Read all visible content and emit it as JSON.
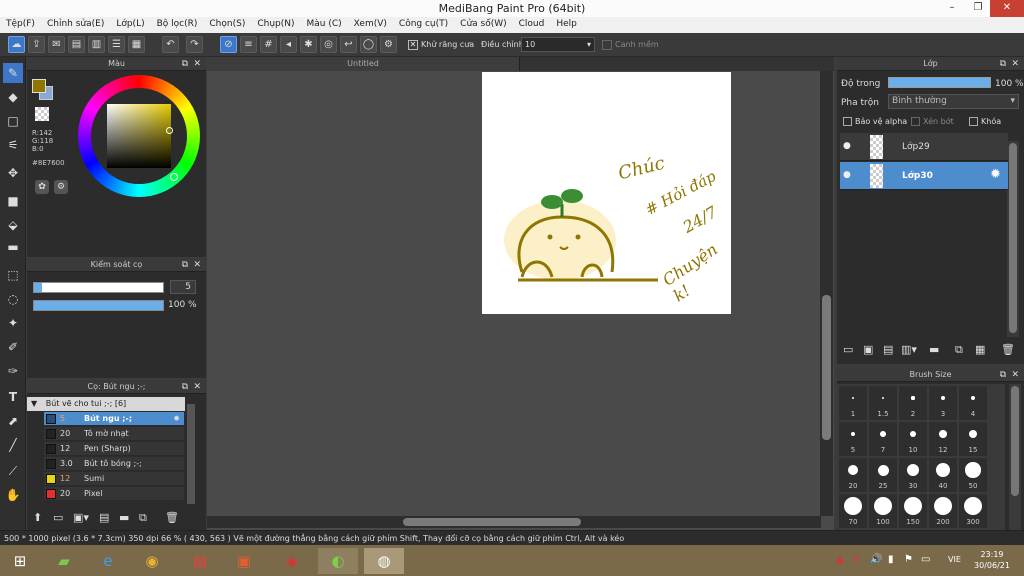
{
  "window": {
    "title": "MediBang Paint Pro (64bit)"
  },
  "menu": [
    "Tệp(F)",
    "Chỉnh sửa(E)",
    "Lớp(L)",
    "Bộ lọc(R)",
    "Chọn(S)",
    "Chụp(N)",
    "Màu (C)",
    "Xem(V)",
    "Công cụ(T)",
    "Cửa số(W)",
    "Cloud",
    "Help"
  ],
  "toolbar": {
    "antialias_label": "Khử răng cưa",
    "correction_label": "Điều chỉnh",
    "correction_value": "10",
    "edge_label": "Canh mềm"
  },
  "color_panel": {
    "title": "Màu",
    "r": "R:142",
    "g": "G:118",
    "b": "B:0",
    "hex": "#8E7600",
    "main_color": "#8E7600",
    "sub_color": "#ffffff"
  },
  "brush_control": {
    "title": "Kiểm soát cọ",
    "size": "5",
    "size_fraction": 0.06,
    "opacity": "100 %",
    "opacity_fraction": 1.0
  },
  "brush_panel": {
    "title": "Cọ: Bút ngu ;-;",
    "group": "Bút vẽ cho tui ;-; [6]",
    "items": [
      {
        "size": "5",
        "name": "Bút ngu ;-;",
        "color": "#2b4f7a"
      },
      {
        "size": "20",
        "name": "Tô mờ nhạt",
        "color": "#222222"
      },
      {
        "size": "12",
        "name": "Pen (Sharp)",
        "color": "#222222"
      },
      {
        "size": "3.0",
        "name": "Bút tô bóng ;-;",
        "color": "#222222"
      },
      {
        "size": "12",
        "name": "Sumi",
        "color": "#e7d21c"
      },
      {
        "size": "20",
        "name": "Pixel",
        "color": "#e03030"
      }
    ]
  },
  "document": {
    "tab": "Untitled"
  },
  "layer_panel": {
    "title": "Lớp",
    "opacity_label": "Độ trong",
    "opacity_value": "100 %",
    "blend_label": "Pha trộn",
    "blend_value": "Bình thường",
    "protect_alpha": "Bảo vệ alpha",
    "clipping": "Xén bớt",
    "lock": "Khóa",
    "layers": [
      {
        "name": "Lớp29",
        "selected": false
      },
      {
        "name": "Lớp30",
        "selected": true
      }
    ]
  },
  "brush_size_panel": {
    "title": "Brush Size",
    "sizes": [
      "1",
      "1.5",
      "2",
      "3",
      "4",
      "5",
      "7",
      "10",
      "12",
      "15",
      "20",
      "25",
      "30",
      "40",
      "50",
      "70",
      "100",
      "150",
      "200",
      "300"
    ]
  },
  "statusbar": {
    "text": "500 * 1000 pixel   (3.6 * 7.3cm)   350 dpi   66 %   ( 430, 563 )   Vẽ một đường thẳng bằng cách giữ phím Shift, Thay đổi cỡ cọ bằng cách giữ phím Ctrl, Alt và kéo"
  },
  "taskbar": {
    "lang": "VIE",
    "time": "23:19",
    "date": "30/06/21"
  },
  "artwork_text": [
    "Chúc",
    "# Hỏi đáp",
    "24/7",
    "Chuyện k!"
  ]
}
